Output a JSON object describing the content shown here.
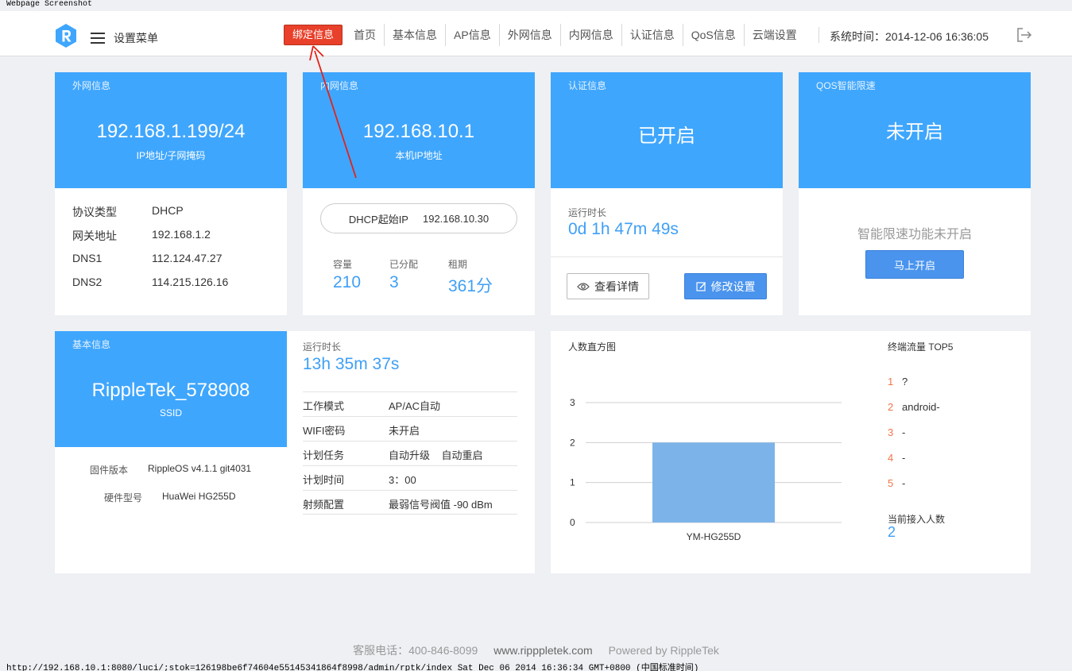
{
  "print": {
    "header": "Webpage Screenshot",
    "footer": "http://192.168.10.1:8080/luci/;stok=126198be6f74604e55145341864f8998/admin/rptk/index Sat Dec 06 2014 16:36:34 GMT+0800 (中国标准时间)"
  },
  "topbar": {
    "menu_label": "设置菜单",
    "nav": [
      {
        "label": "绑定信息",
        "active": true
      },
      {
        "label": "首页"
      },
      {
        "label": "基本信息"
      },
      {
        "label": "AP信息"
      },
      {
        "label": "外网信息"
      },
      {
        "label": "内网信息"
      },
      {
        "label": "认证信息"
      },
      {
        "label": "QoS信息"
      },
      {
        "label": "云端设置"
      }
    ],
    "system_time": "系统时间：2014-12-06 16:36:05",
    "accent": "#3fa6fd",
    "active_color": "#e8402a"
  },
  "wan": {
    "tag": "外网信息",
    "ip": "192.168.1.199/24",
    "ip_label": "IP地址/子网掩码",
    "rows": [
      {
        "k": "协议类型",
        "v": "DHCP"
      },
      {
        "k": "网关地址",
        "v": "192.168.1.2"
      },
      {
        "k": "DNS1",
        "v": "112.124.47.27"
      },
      {
        "k": "DNS2",
        "v": "114.215.126.16"
      }
    ]
  },
  "lan": {
    "tag": "内网信息",
    "ip": "192.168.10.1",
    "ip_label": "本机IP地址",
    "dhcp_start_label": "DHCP起始IP",
    "dhcp_start": "192.168.10.30",
    "stats": [
      {
        "label": "容量",
        "value": "210"
      },
      {
        "label": "已分配",
        "value": "3"
      },
      {
        "label": "租期",
        "value": "361分"
      }
    ]
  },
  "auth": {
    "tag": "认证信息",
    "status": "已开启",
    "uptime_label": "运行时长",
    "uptime": "0d 1h 47m 49s",
    "details_button": "查看详情",
    "edit_button": "修改设置"
  },
  "qos": {
    "tag": "QOS智能限速",
    "status": "未开启",
    "message": "智能限速功能未开启",
    "enable_button": "马上开启"
  },
  "basic": {
    "tag": "基本信息",
    "ssid": "RippleTek_578908",
    "ssid_label": "SSID",
    "firmware_label": "固件版本",
    "firmware": "RippleOS v4.1.1 git4031",
    "hardware_label": "硬件型号",
    "hardware": "HuaWei HG255D",
    "uptime_label": "运行时长",
    "uptime": "13h 35m 37s",
    "rows": [
      {
        "k": "工作模式",
        "v": "AP/AC自动"
      },
      {
        "k": "WIFI密码",
        "v": "未开启"
      },
      {
        "k": "计划任务",
        "v": "自动升级    自动重启"
      },
      {
        "k": "计划时间",
        "v": "3：00"
      },
      {
        "k": "射频配置",
        "v": "最弱信号阀值 -90 dBm"
      }
    ]
  },
  "histogram": {
    "title": "人数直方图"
  },
  "chart_data": {
    "type": "bar",
    "categories": [
      "YM-HG255D"
    ],
    "values": [
      2
    ],
    "title": "人数直方图",
    "ylim": [
      0,
      3
    ],
    "yticks": [
      0,
      1,
      2,
      3
    ],
    "grid": true,
    "color": "#7cb4ea"
  },
  "top5": {
    "title": "终端流量 TOP5",
    "items": [
      {
        "rank": "1",
        "name": "?"
      },
      {
        "rank": "2",
        "name": "android-"
      },
      {
        "rank": "3",
        "name": "-"
      },
      {
        "rank": "4",
        "name": "-"
      },
      {
        "rank": "5",
        "name": "-"
      }
    ],
    "current_label": "当前接入人数",
    "current": "2"
  },
  "footer": {
    "phone": "客服电话：400-846-8099",
    "site": "www.ripppletek.com",
    "powered": "Powered by RippleTek"
  },
  "icons": {
    "logo": "ripple-logo-icon",
    "menu": "hamburger-icon",
    "logout": "logout-icon",
    "eye": "eye-icon",
    "edit": "edit-icon"
  }
}
